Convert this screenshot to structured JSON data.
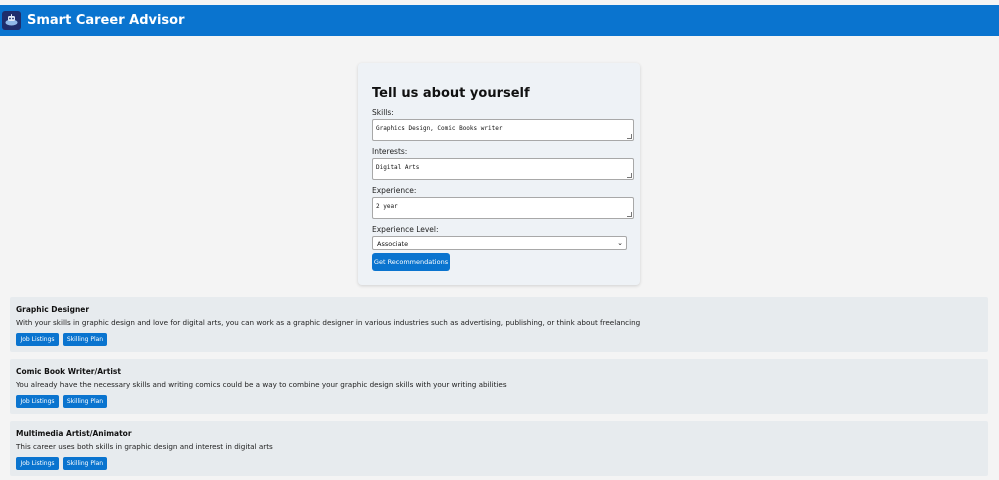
{
  "header": {
    "title": "Smart Career Advisor",
    "logo_icon": "robot-icon"
  },
  "form": {
    "title": "Tell us about yourself",
    "skills_label": "Skills:",
    "skills_value": "Graphics Design, Comic Books writer",
    "interests_label": "Interests:",
    "interests_value": "Digital Arts",
    "experience_label": "Experience:",
    "experience_value": "2 year",
    "level_label": "Experience Level:",
    "level_value": "Associate",
    "submit_label": "Get Recommendations"
  },
  "recommendations": [
    {
      "title": "Graphic Designer",
      "description": "With your skills in graphic design and love for digital arts, you can work as a graphic designer in various industries such as advertising, publishing, or think about freelancing",
      "jobs_label": "Job Listings",
      "skilling_label": "Skilling Plan"
    },
    {
      "title": "Comic Book Writer/Artist",
      "description": "You already have the necessary skills and writing comics could be a way to combine your graphic design skills with your writing abilities",
      "jobs_label": "Job Listings",
      "skilling_label": "Skilling Plan"
    },
    {
      "title": "Multimedia Artist/Animator",
      "description": "This career uses both skills in graphic design and interest in digital arts",
      "jobs_label": "Job Listings",
      "skilling_label": "Skilling Plan"
    }
  ],
  "colors": {
    "accent": "#0a74cf",
    "card": "#eef2f6",
    "rec_card": "#e7ebee"
  }
}
